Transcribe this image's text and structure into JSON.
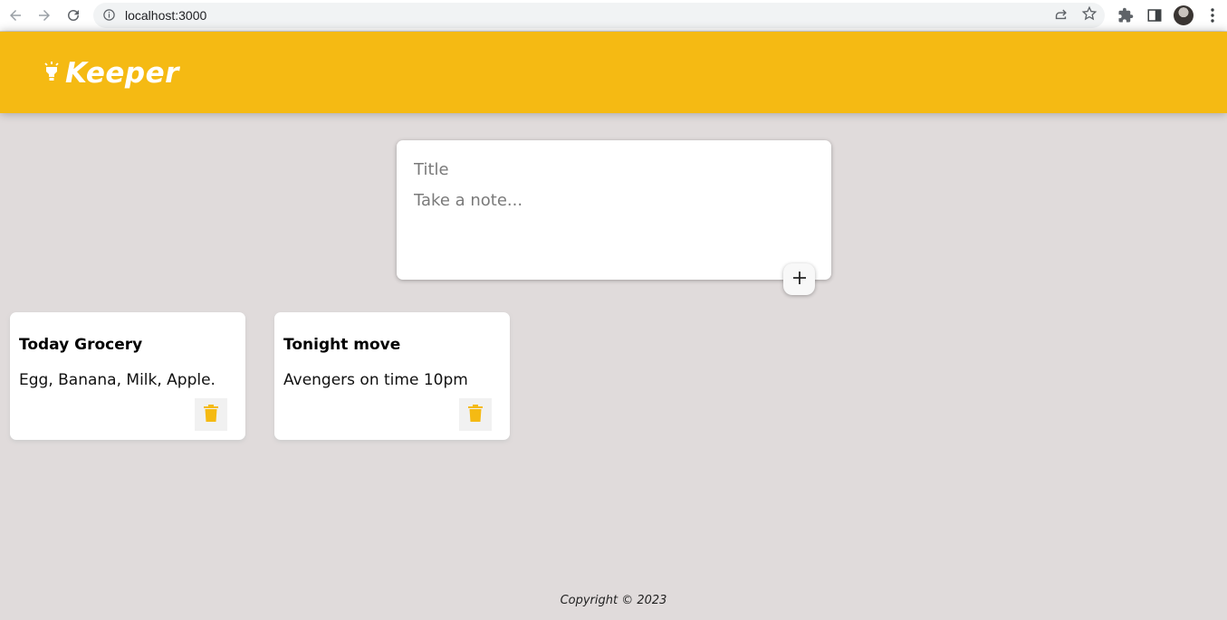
{
  "browser": {
    "url": "localhost:3000",
    "icons": [
      "back-arrow-icon",
      "forward-arrow-icon",
      "reload-icon",
      "info-icon",
      "share-icon",
      "star-icon",
      "extensions-icon",
      "side-panel-icon",
      "profile-avatar",
      "menu-dots-icon"
    ]
  },
  "header": {
    "brand_icon": "lightbulb-icon",
    "title": "Keeper",
    "color": "#f5ba13"
  },
  "create_area": {
    "title_placeholder": "Title",
    "content_placeholder": "Take a note...",
    "add_icon": "plus-icon"
  },
  "notes": [
    {
      "title": "Today Grocery",
      "content": "Egg, Banana, Milk, Apple.",
      "delete_icon": "trash-icon"
    },
    {
      "title": "Tonight move",
      "content": "Avengers on time 10pm",
      "delete_icon": "trash-icon"
    }
  ],
  "footer": {
    "text": "Copyright © 2023"
  },
  "colors": {
    "accent": "#f5ba13",
    "background": "#e0dbdb"
  }
}
